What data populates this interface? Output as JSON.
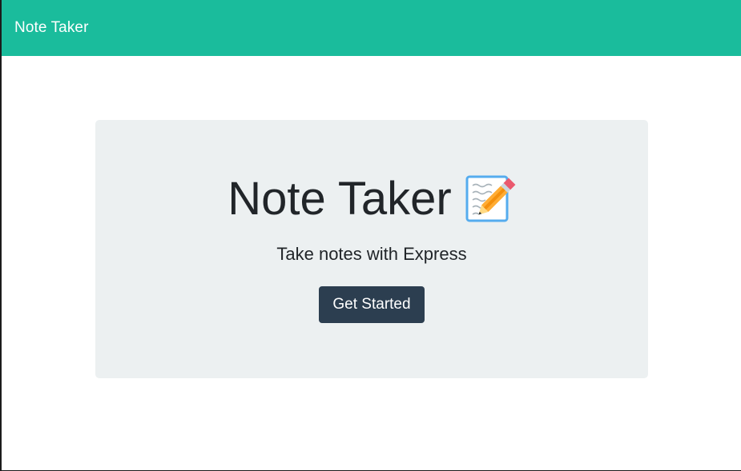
{
  "navbar": {
    "brand": "Note Taker",
    "background": "#1abc9c"
  },
  "hero": {
    "title": "Note Taker",
    "icon": "memo-icon",
    "subtitle": "Take notes with Express",
    "cta_label": "Get Started",
    "cta_color": "#2c3e50",
    "panel_color": "#ecf0f1"
  }
}
